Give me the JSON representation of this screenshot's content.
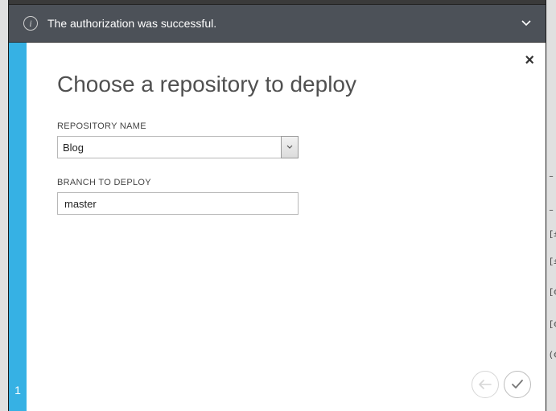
{
  "notification": {
    "message": "The authorization was successful."
  },
  "step": {
    "number": "1"
  },
  "page": {
    "title": "Choose a repository to deploy"
  },
  "form": {
    "repo": {
      "label": "REPOSITORY NAME",
      "value": "Blog"
    },
    "branch": {
      "label": "BRANCH TO DEPLOY",
      "value": "master"
    }
  }
}
